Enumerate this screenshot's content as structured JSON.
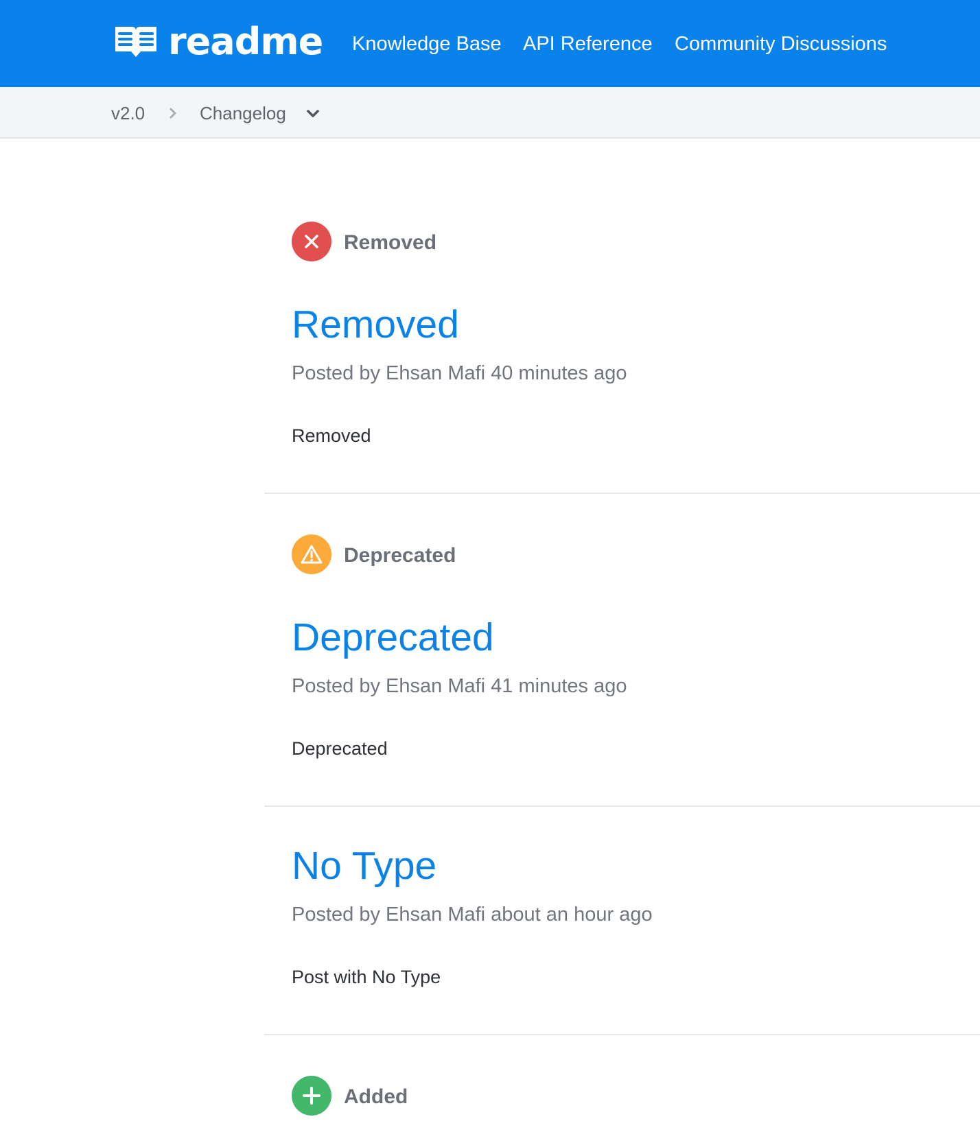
{
  "header": {
    "logo_text": "readme",
    "nav": [
      "Knowledge Base",
      "API Reference",
      "Community Discussions"
    ]
  },
  "breadcrumb": {
    "version": "v2.0",
    "current": "Changelog"
  },
  "posts": [
    {
      "type_label": "Removed",
      "type_icon": "x-circle-icon",
      "type_color": "#e14f4f",
      "title": "Removed",
      "meta": "Posted by Ehsan Mafi 40 minutes ago",
      "body": "Removed"
    },
    {
      "type_label": "Deprecated",
      "type_icon": "warning-icon",
      "type_color": "#fbaa3a",
      "title": "Deprecated",
      "meta": "Posted by Ehsan Mafi 41 minutes ago",
      "body": "Deprecated"
    },
    {
      "title": "No Type",
      "meta": "Posted by Ehsan Mafi about an hour ago",
      "body": "Post with No Type"
    },
    {
      "type_label": "Added",
      "type_icon": "plus-circle-icon",
      "type_color": "#43b86a"
    }
  ],
  "colors": {
    "header_bg": "#0982ec",
    "link": "#0b83e6",
    "subbar_bg": "#f4f5f7"
  }
}
